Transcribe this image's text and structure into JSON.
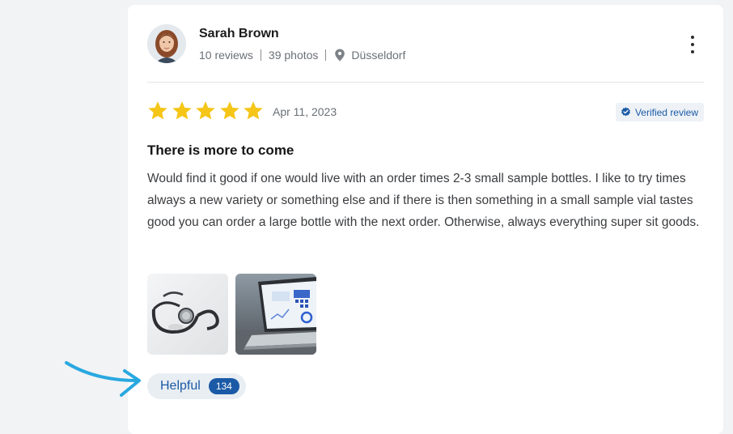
{
  "reviewer": {
    "name": "Sarah Brown",
    "reviews": "10 reviews",
    "photos": "39 photos",
    "location": "Düsseldorf"
  },
  "review": {
    "rating": 5,
    "max_rating": 5,
    "date": "Apr 11, 2023",
    "verified_label": "Verified review",
    "title": "There is more to come",
    "body": "Would find it good if one would live with an order times 2-3 small sample bottles. I like to try times always a new variety or something else and if there is then something in a small sample vial tastes good you can order a large bottle with the next order. Otherwise, always everything super sit goods.",
    "photo_icons": [
      "stethoscope-photo",
      "laptop-dashboard-photo"
    ]
  },
  "helpful": {
    "label": "Helpful",
    "count": "134"
  },
  "colors": {
    "star": "#f5c518",
    "accent": "#1b5aa6",
    "arrow": "#29a8e0"
  }
}
